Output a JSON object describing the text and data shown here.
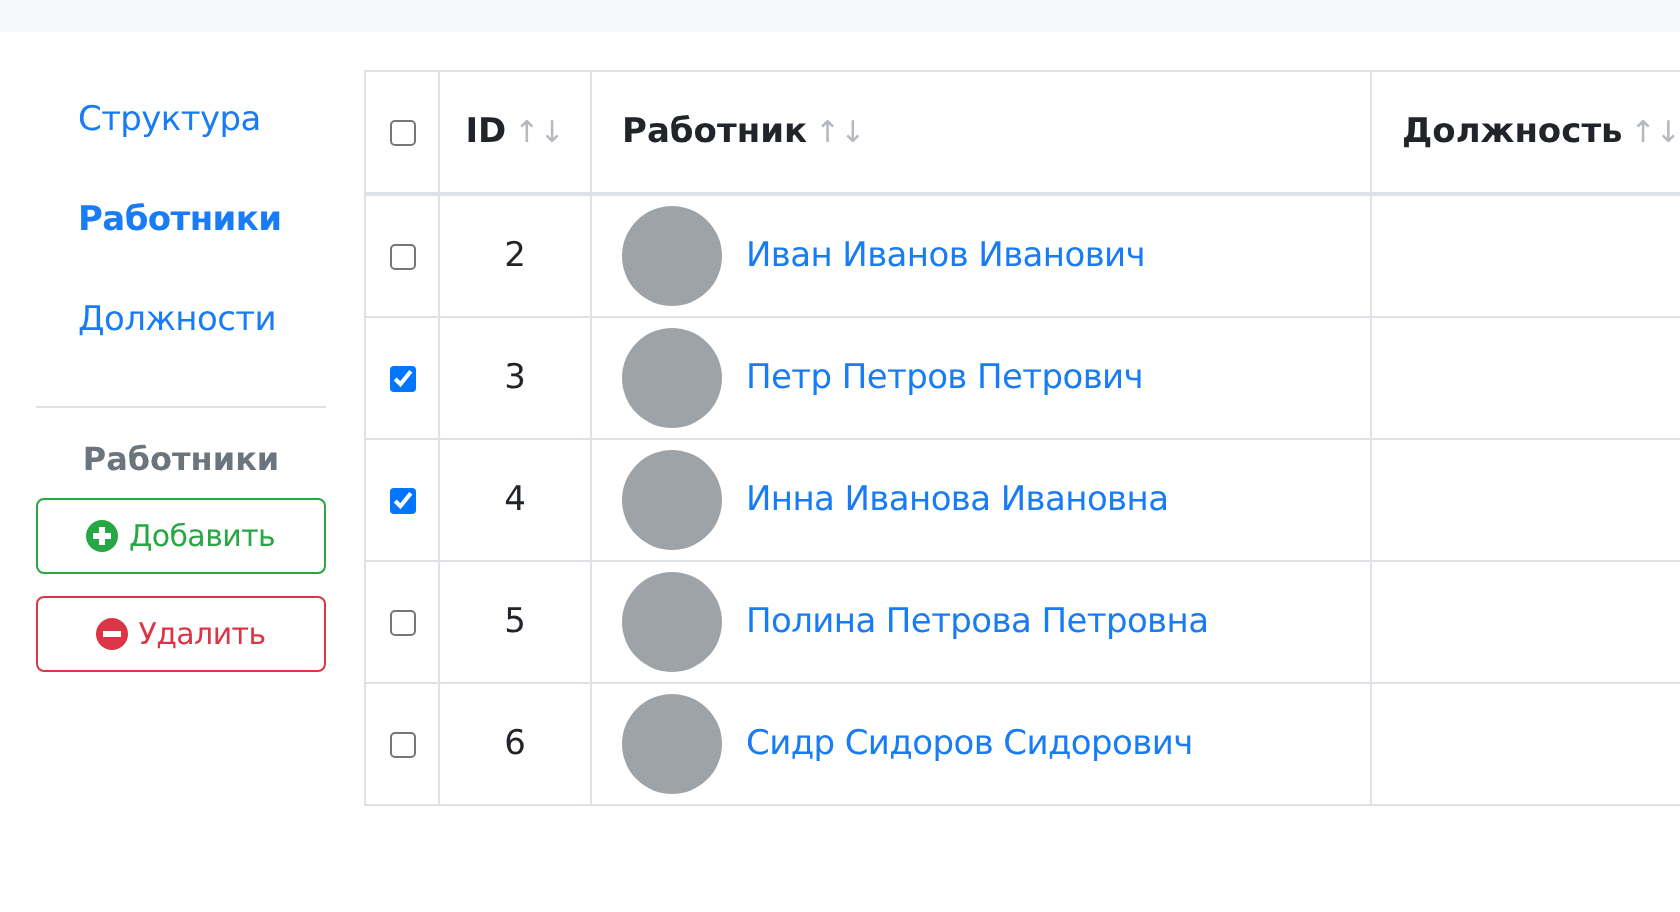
{
  "sidebar": {
    "items": [
      {
        "label": "Структура",
        "selected": false
      },
      {
        "label": "Работники",
        "selected": true
      },
      {
        "label": "Должности",
        "selected": false
      }
    ],
    "section_title": "Работники",
    "buttons": [
      {
        "kind": "add",
        "label": "Добавить"
      },
      {
        "kind": "delete",
        "label": "Удалить"
      }
    ]
  },
  "table": {
    "select_all": {
      "checked": false
    },
    "columns": [
      {
        "label": "ID",
        "sort": "↑↓"
      },
      {
        "label": "Работник",
        "sort": "↑↓"
      },
      {
        "label": "Должность",
        "sort": "↑↓"
      }
    ],
    "rows": [
      {
        "checked": false,
        "id": "2",
        "name": "Иван Иванов Иванович"
      },
      {
        "checked": true,
        "id": "3",
        "name": "Петр Петров Петрович"
      },
      {
        "checked": true,
        "id": "4",
        "name": "Инна Иванова Ивановна"
      },
      {
        "checked": false,
        "id": "5",
        "name": "Полина Петрова Петровна"
      },
      {
        "checked": false,
        "id": "6",
        "name": "Сидр Сидоров Сидорович"
      }
    ]
  }
}
